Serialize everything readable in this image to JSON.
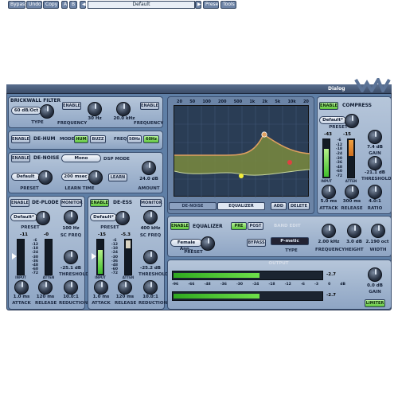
{
  "toolbar": {
    "bypass": "Bypass",
    "undo": "Undo",
    "copy": "Copy",
    "ab_a": "A",
    "ab_b": "B",
    "preset_value": "Default",
    "preset_menu": "Preset",
    "tools": "Tools",
    "dialog": "Dialog"
  },
  "brickwall": {
    "title": "BRICKWALL FILTER",
    "enable": "ENABLE",
    "enable2": "ENABLE",
    "type_value": "60 dB/Oct",
    "type_label": "TYPE",
    "freq1_value": "30 Hz",
    "freq1_label": "FREQUENCY",
    "freq2_value": "20.0 kHz",
    "freq2_label": "FREQUENCY"
  },
  "dehum": {
    "enable": "ENABLE",
    "title": "DE-HUM",
    "mode_label": "MODE",
    "mode_hum": "HUM",
    "mode_buzz": "BUZZ",
    "freq_label": "FREQ",
    "freq_50": "50Hz",
    "freq_60": "60Hz"
  },
  "denoise": {
    "enable": "ENABLE",
    "title": "DE-NOISE",
    "mono": "Mono",
    "dsp_mode": "DSP MODE",
    "preset_value": "Default",
    "preset_label": "PRESET",
    "learn_time_value": "200 msec",
    "learn_time_label": "LEARN TIME",
    "learn": "LEARN",
    "amount_value": "24.0 dB",
    "amount_label": "AMOUNT"
  },
  "deplode": {
    "enable": "ENABLE",
    "title": "DE-PLODE",
    "monitor": "MONITOR",
    "preset_value": "Default*",
    "preset_label": "PRESET",
    "sc_freq_value": "100 Hz",
    "sc_freq_label": "SC FREQ",
    "meter_in": "-11",
    "meter_att": "-0",
    "threshold_value": "-25.1 dB",
    "threshold_label": "THRESHOLD",
    "attack_value": "1.0 ms",
    "attack_label": "ATTACK",
    "release_value": "120 ms",
    "release_label": "RELEASE",
    "reduction_value": "10.0:1",
    "reduction_label": "REDUCTION"
  },
  "deess": {
    "enable": "ENABLE",
    "title": "DE-ESS",
    "monitor": "MONITOR",
    "preset_value": "Default*",
    "preset_label": "PRESET",
    "sc_freq_value": "400 kHz",
    "sc_freq_label": "SC FREQ",
    "meter_in": "-15",
    "meter_att": "-5.3",
    "threshold_value": "-25.2 dB",
    "threshold_label": "THRESHOLD",
    "attack_value": "1.0 ms",
    "attack_label": "ATTACK",
    "release_value": "120 ms",
    "release_label": "RELEASE",
    "reduction_value": "10.0:1",
    "reduction_label": "REDUCTION"
  },
  "meter_scale": [
    "-6",
    "-12",
    "-18",
    "-24",
    "-30",
    "-36",
    "-48",
    "-60",
    "-72"
  ],
  "meter_small_labels": {
    "input": "INPUT",
    "atten": "ATTEN"
  },
  "graph": {
    "freq_ticks": [
      "20",
      "50",
      "100",
      "200",
      "500",
      "1k",
      "2k",
      "5k",
      "10k",
      "20"
    ],
    "tab_denoise": "DE-NOISE",
    "tab_equalizer": "EQUALIZER",
    "add": "ADD",
    "delete": "DELETE",
    "eq_curve_color": "#e0a060",
    "band_colors": [
      "#f3ef3a",
      "#e04040",
      "#e0a060"
    ]
  },
  "equalizer": {
    "enable": "ENABLE",
    "title": "EQUALIZER",
    "pre": "PRE",
    "post": "POST",
    "preset_value": "Female Ann..",
    "preset_label": "PRESET",
    "band_edit": "BAND EDIT",
    "bypass": "BYPASS",
    "type_value": "P-metic",
    "type_label": "TYPE",
    "frequency_value": "2.00 kHz",
    "frequency_label": "FREQUENCY",
    "height_value": "3.0 dB",
    "height_label": "HEIGHT",
    "width_value": "2.190 oct",
    "width_label": "WIDTH"
  },
  "compress": {
    "enable": "ENABLE",
    "title": "COMPRESS",
    "preset_value": "Default*",
    "preset_label": "PRESET",
    "gain_value": "7.4 dB",
    "gain_label": "GAIN",
    "meter_in": "-43",
    "meter_att": "-15",
    "threshold_value": "-21.1 dB",
    "threshold_label": "THRESHOLD",
    "attack_value": "5.0 ms",
    "attack_label": "ATTACK",
    "release_value": "300 ms",
    "release_label": "RELEASE",
    "ratio_value": "4.0:1",
    "ratio_label": "RATIO"
  },
  "output": {
    "title": "OUTPUT",
    "scale": [
      "-96",
      "-66",
      "-48",
      "-36",
      "-30",
      "-24",
      "-18",
      "-12",
      "-6",
      "-3",
      "0",
      "dB"
    ],
    "left_peak": "-2.7",
    "right_peak": "-2.7",
    "left_level": 0.58,
    "right_level": 0.58,
    "gain_value": "0.0 dB",
    "gain_label": "GAIN",
    "limiter": "LIMITER"
  }
}
